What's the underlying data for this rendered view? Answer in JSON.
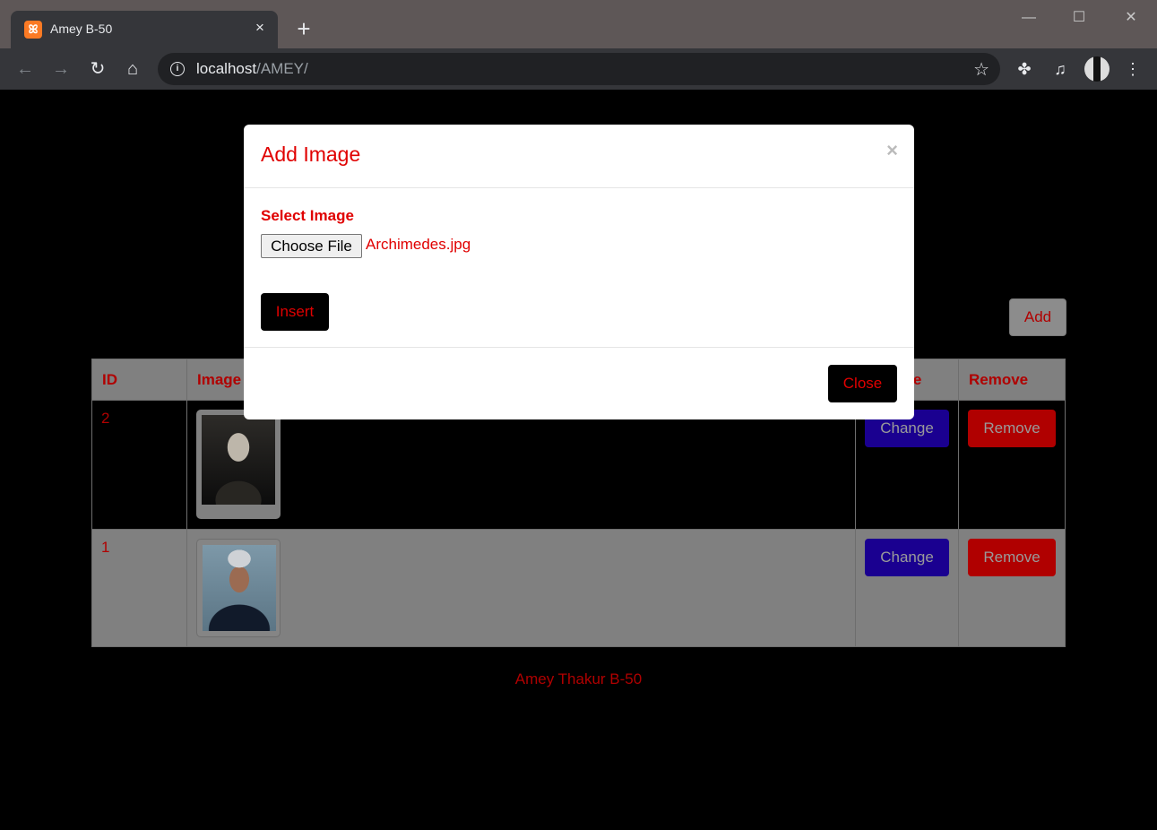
{
  "browser": {
    "tab_title": "Amey B-50",
    "tab_close": "×",
    "new_tab": "+",
    "url_host": "localhost",
    "url_path": "/AMEY/",
    "window_controls": {
      "minimize": "—",
      "maximize": "☐",
      "close": "✕"
    },
    "icons": [
      "xampp-icon",
      "back-icon",
      "forward-icon",
      "reload-icon",
      "home-icon",
      "info-icon",
      "star-icon",
      "extensions-icon",
      "reading-list-icon",
      "profile-avatar",
      "menu-icon"
    ]
  },
  "page": {
    "add_button": "Add",
    "table": {
      "headers": [
        "ID",
        "Image",
        "Change",
        "Remove"
      ],
      "rows": [
        {
          "id": "2",
          "image": "photo-marie-curie",
          "change_label": "Change",
          "remove_label": "Remove"
        },
        {
          "id": "1",
          "image": "photo-apj-abdul-kalam",
          "change_label": "Change",
          "remove_label": "Remove"
        }
      ]
    },
    "footer": "Amey Thakur B-50"
  },
  "modal": {
    "title": "Add Image",
    "close_x": "×",
    "field_label": "Select Image",
    "file_button": "Choose File",
    "file_name": "Archimedes.jpg",
    "insert_button": "Insert",
    "close_button": "Close"
  },
  "colors": {
    "accent_red": "#e00000",
    "dark_red": "#b00000",
    "change_blue": "#1a0090",
    "page_bg": "#000000"
  }
}
